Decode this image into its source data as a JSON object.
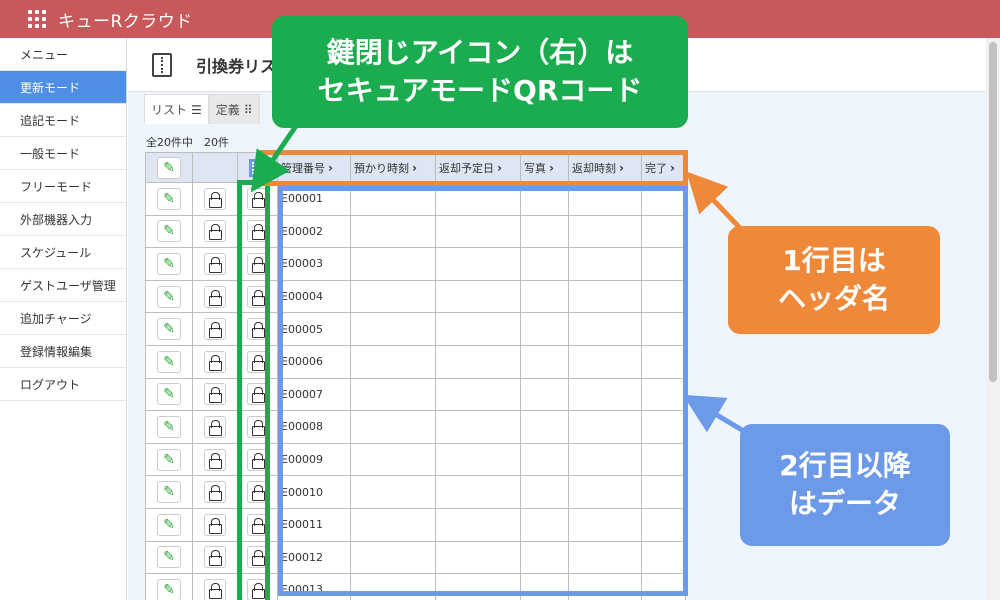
{
  "app": {
    "title": "キューRクラウド"
  },
  "sidebar": {
    "items": [
      {
        "label": "メニュー",
        "active": false
      },
      {
        "label": "更新モード",
        "active": true
      },
      {
        "label": "追記モード",
        "active": false
      },
      {
        "label": "一般モード",
        "active": false
      },
      {
        "label": "フリーモード",
        "active": false
      },
      {
        "label": "外部機器入力",
        "active": false
      },
      {
        "label": "スケジュール",
        "active": false
      },
      {
        "label": "ゲストユーザ管理",
        "active": false
      },
      {
        "label": "追加チャージ",
        "active": false
      },
      {
        "label": "登録情報編集",
        "active": false
      },
      {
        "label": "ログアウト",
        "active": false
      }
    ]
  },
  "page": {
    "title": "引換券リス"
  },
  "tabs": [
    {
      "label": "リスト",
      "icon": "list-icon"
    },
    {
      "label": "定義",
      "icon": "grid-icon"
    }
  ],
  "count": {
    "text": "全20件中　20件"
  },
  "table": {
    "headers": [
      "管理番号",
      "預かり時刻",
      "返却予定日",
      "写真",
      "返却時刻",
      "完了"
    ],
    "rows": [
      "E00001",
      "E00002",
      "E00003",
      "E00004",
      "E00005",
      "E00006",
      "E00007",
      "E00008",
      "E00009",
      "E00010",
      "E00011",
      "E00012",
      "E00013"
    ]
  },
  "annotations": {
    "green": {
      "line1": "鍵閉じアイコン（右）は",
      "line2": "セキュアモードQRコード",
      "color": "#1aac4e"
    },
    "orange": {
      "line1": "1行目は",
      "line2": "ヘッダ名",
      "color": "#f0883a"
    },
    "blue": {
      "line1": "2行目以降",
      "line2": "はデータ",
      "color": "#6c9ae8"
    }
  }
}
